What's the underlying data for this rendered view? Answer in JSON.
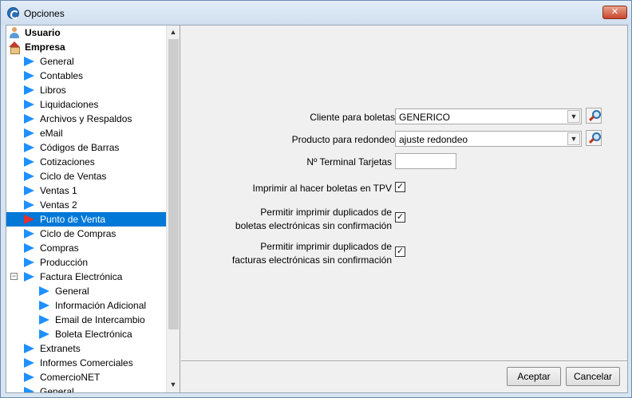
{
  "window": {
    "title": "Opciones",
    "close_label": "✕"
  },
  "tree": {
    "items": [
      {
        "label": "Usuario",
        "kind": "user",
        "bold": true
      },
      {
        "label": "Empresa",
        "kind": "company",
        "bold": true
      },
      {
        "label": "General",
        "kind": "arrow",
        "level": 1
      },
      {
        "label": "Contables",
        "kind": "arrow",
        "level": 1
      },
      {
        "label": "Libros",
        "kind": "arrow",
        "level": 1
      },
      {
        "label": "Liquidaciones",
        "kind": "arrow",
        "level": 1
      },
      {
        "label": "Archivos y Respaldos",
        "kind": "arrow",
        "level": 1
      },
      {
        "label": "eMail",
        "kind": "arrow",
        "level": 1
      },
      {
        "label": "Códigos de Barras",
        "kind": "arrow",
        "level": 1
      },
      {
        "label": "Cotizaciones",
        "kind": "arrow",
        "level": 1
      },
      {
        "label": "Ciclo de Ventas",
        "kind": "arrow",
        "level": 1
      },
      {
        "label": "Ventas 1",
        "kind": "arrow",
        "level": 1
      },
      {
        "label": "Ventas 2",
        "kind": "arrow",
        "level": 1
      },
      {
        "label": "Punto de Venta",
        "kind": "arrow",
        "level": 1,
        "selected": true
      },
      {
        "label": "Ciclo de Compras",
        "kind": "arrow",
        "level": 1
      },
      {
        "label": "Compras",
        "kind": "arrow",
        "level": 1
      },
      {
        "label": "Producción",
        "kind": "arrow",
        "level": 1
      },
      {
        "label": "Factura Electrónica",
        "kind": "arrow",
        "level": 1,
        "expander": "−"
      },
      {
        "label": "General",
        "kind": "arrow",
        "level": 2
      },
      {
        "label": "Información Adicional",
        "kind": "arrow",
        "level": 2
      },
      {
        "label": "Email de Intercambio",
        "kind": "arrow",
        "level": 2
      },
      {
        "label": "Boleta Electrónica",
        "kind": "arrow",
        "level": 2
      },
      {
        "label": "Extranets",
        "kind": "arrow",
        "level": 1
      },
      {
        "label": "Informes Comerciales",
        "kind": "arrow",
        "level": 1
      },
      {
        "label": "ComercioNET",
        "kind": "arrow",
        "level": 1
      },
      {
        "label": "General",
        "kind": "arrow",
        "level": 0
      }
    ],
    "scroll_up": "▲",
    "scroll_down": "▼"
  },
  "form": {
    "cliente_label": "Cliente para boletas",
    "cliente_value": "GENERICO",
    "producto_label": "Producto para redondeo",
    "producto_value": "ajuste redondeo",
    "terminal_label": "Nº Terminal Tarjetas",
    "terminal_value": "",
    "imprimir_tpv_label": "Imprimir al hacer boletas en TPV",
    "dup_boletas_line1": "Permitir imprimir duplicados de",
    "dup_boletas_line2": "boletas electrónicas sin confirmación",
    "dup_facturas_line1": "Permitir imprimir duplicados de",
    "dup_facturas_line2": "facturas electrónicas sin confirmación",
    "checkmark": "✓",
    "dropdown_glyph": "▼"
  },
  "buttons": {
    "accept": "Aceptar",
    "cancel": "Cancelar"
  },
  "colors": {
    "selection": "#0078d7",
    "arrow": "#1e90ff",
    "arrow_selected": "#e53030"
  }
}
